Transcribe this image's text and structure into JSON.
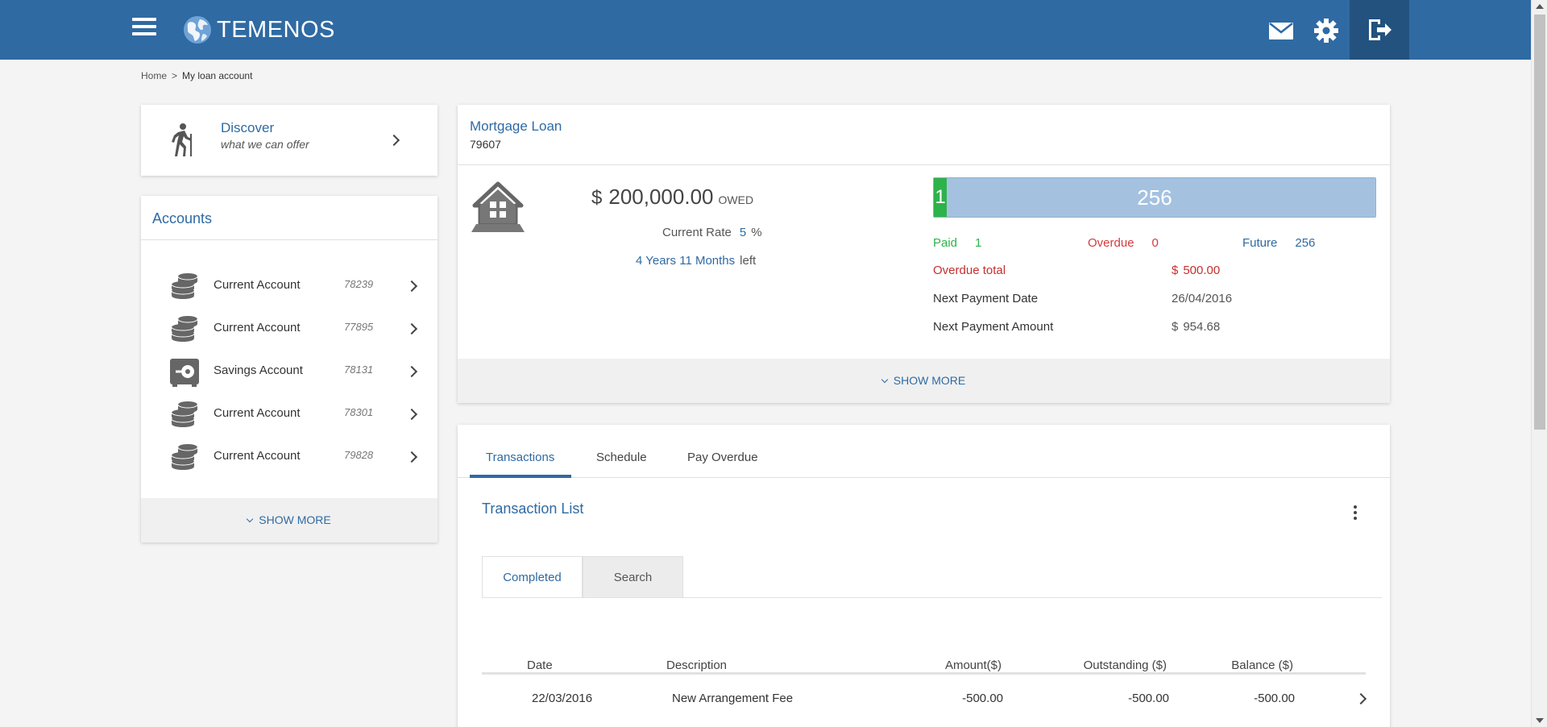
{
  "header": {
    "brand": "TEMENOS",
    "icons": {
      "menu": "hamburger-menu-icon",
      "mail": "mail-icon",
      "settings": "gear-icon",
      "logout": "logout-icon"
    },
    "colors": {
      "bar": "#2f6aa3",
      "logout_bg": "#23527f"
    }
  },
  "breadcrumb": {
    "home": "Home",
    "separator": ">",
    "current": "My loan account"
  },
  "discover": {
    "title": "Discover",
    "subtitle": "what we can offer"
  },
  "accounts": {
    "title": "Accounts",
    "items": [
      {
        "name": "Current Account",
        "number": "78239",
        "icon": "coins-icon"
      },
      {
        "name": "Current Account",
        "number": "77895",
        "icon": "coins-icon"
      },
      {
        "name": "Savings Account",
        "number": "78131",
        "icon": "safe-icon"
      },
      {
        "name": "Current Account",
        "number": "78301",
        "icon": "coins-icon"
      },
      {
        "name": "Current Account",
        "number": "79828",
        "icon": "coins-icon"
      }
    ],
    "show_more": "SHOW MORE"
  },
  "loan": {
    "title": "Mortgage Loan",
    "number": "79607",
    "currency": "$",
    "owed_amount": "200,000.00",
    "owed_label": "OWED",
    "rate_label": "Current Rate",
    "rate_value": "5",
    "rate_unit": "%",
    "term_value": "4 Years 11 Months",
    "term_suffix": "left",
    "progress": {
      "paid": "1",
      "future": "256",
      "paid_fraction": 0.0039
    },
    "stats": {
      "paid_label": "Paid",
      "paid_value": "1",
      "overdue_label": "Overdue",
      "overdue_value": "0",
      "future_label": "Future",
      "future_value": "256"
    },
    "overdue_total_label": "Overdue total",
    "overdue_total_currency": "$",
    "overdue_total_value": "500.00",
    "next_date_label": "Next Payment Date",
    "next_date_value": "26/04/2016",
    "next_amount_label": "Next Payment Amount",
    "next_amount_currency": "$",
    "next_amount_value": "954.68",
    "show_more": "SHOW MORE",
    "colors": {
      "paid": "#2db34a",
      "overdue": "#d43b3b",
      "future": "#2f6aa3"
    }
  },
  "transactions": {
    "tabs": [
      "Transactions",
      "Schedule",
      "Pay Overdue"
    ],
    "list_title": "Transaction List",
    "subtabs": [
      "Completed",
      "Search"
    ],
    "columns": [
      "Date",
      "Description",
      "Amount($)",
      "Outstanding ($)",
      "Balance ($)"
    ],
    "rows": [
      {
        "date": "22/03/2016",
        "description": "New Arrangement Fee",
        "amount": "-500.00",
        "outstanding": "-500.00",
        "balance": "-500.00"
      }
    ]
  }
}
